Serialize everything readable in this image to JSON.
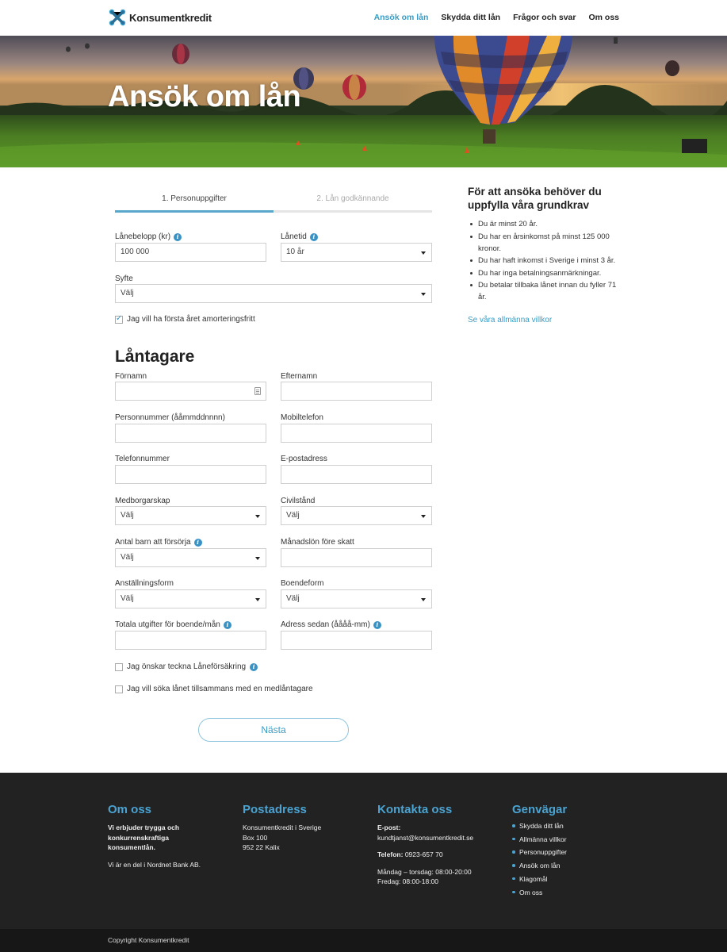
{
  "header": {
    "logo_text": "Konsumentkredit",
    "nav": [
      {
        "label": "Ansök om lån",
        "active": true
      },
      {
        "label": "Skydda ditt lån",
        "active": false
      },
      {
        "label": "Frågor och svar",
        "active": false
      },
      {
        "label": "Om oss",
        "active": false
      }
    ]
  },
  "hero": {
    "title": "Ansök om lån"
  },
  "steps": [
    {
      "label": "1. Personuppgifter",
      "active": true
    },
    {
      "label": "2. Lån godkännande",
      "active": false
    }
  ],
  "loan": {
    "amount_label": "Lånebelopp (kr)",
    "amount_value": "100 000",
    "term_label": "Lånetid",
    "term_value": "10 år",
    "purpose_label": "Syfte",
    "purpose_value": "Välj",
    "amortization_free_label": "Jag vill ha första året amorteringsfritt",
    "amortization_free_checked": true
  },
  "borrower": {
    "title": "Låntagare",
    "first_name_label": "Förnamn",
    "last_name_label": "Efternamn",
    "personal_number_label": "Personnummer (ååmmddnnnn)",
    "mobile_label": "Mobiltelefon",
    "phone_label": "Telefonnummer",
    "email_label": "E-postadress",
    "citizenship_label": "Medborgarskap",
    "citizenship_value": "Välj",
    "marital_label": "Civilstånd",
    "marital_value": "Välj",
    "children_label": "Antal barn att försörja",
    "children_value": "Välj",
    "salary_label": "Månadslön före skatt",
    "employment_label": "Anställningsform",
    "employment_value": "Välj",
    "housing_label": "Boendeform",
    "housing_value": "Välj",
    "housing_cost_label": "Totala utgifter för boende/mån",
    "address_since_label": "Adress sedan (åååå-mm)",
    "insurance_label": "Jag önskar teckna Låneförsäkring",
    "co_applicant_label": "Jag vill söka lånet tillsammans med en medlåntagare",
    "next_button": "Nästa"
  },
  "sidebar": {
    "title": "För att ansöka behöver du uppfylla våra grundkrav",
    "requirements": [
      "Du är minst 20 år.",
      "Du har en årsinkomst på minst 125 000 kronor.",
      "Du har haft inkomst i Sverige i minst 3 år.",
      "Du har inga betalningsanmärkningar.",
      "Du betalar tillbaka lånet innan du fyller 71 år."
    ],
    "terms_link": "Se våra allmänna villkor"
  },
  "footer": {
    "about": {
      "title": "Om oss",
      "text_bold": "Vi erbjuder trygga och konkurrenskraftiga konsumentlån.",
      "text": "Vi är en del i Nordnet Bank AB."
    },
    "address": {
      "title": "Postadress",
      "line1": "Konsumentkredit i Sverige",
      "line2": "Box 100",
      "line3": "952 22 Kalix"
    },
    "contact": {
      "title": "Kontakta oss",
      "email_label": "E-post:",
      "email": "kundtjanst@konsumentkredit.se",
      "phone_label": "Telefon:",
      "phone": "0923-657 70",
      "hours1": "Måndag – torsdag: 08:00-20:00",
      "hours2": "Fredag: 08:00-18:00"
    },
    "shortcuts": {
      "title": "Genvägar",
      "links": [
        "Skydda ditt lån",
        "Allmänna villkor",
        "Personuppgifter",
        "Ansök om lån",
        "Klagomål",
        "Om oss"
      ]
    },
    "copyright": "Copyright Konsumentkredit"
  },
  "colors": {
    "accent": "#3a9cc6",
    "footer_bg": "#222222",
    "footer_heading": "#4aa3d2"
  }
}
